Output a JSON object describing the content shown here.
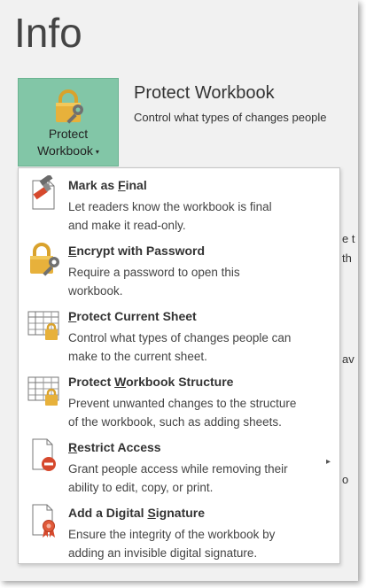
{
  "page": {
    "title": "Info"
  },
  "protect_button": {
    "line1": "Protect",
    "line2": "Workbook",
    "caret": "▾",
    "icon": "lock-key-icon"
  },
  "section": {
    "title": "Protect Workbook",
    "desc": "Control what types of changes people"
  },
  "background_fragments": [
    "e t",
    "th",
    "av",
    "o"
  ],
  "menu": {
    "items": [
      {
        "pre": "Mark as ",
        "key": "F",
        "post": "inal",
        "desc1": "Let readers know the workbook is final",
        "desc2": "and make it read-only.",
        "icon": "mark-as-final-icon"
      },
      {
        "pre": "",
        "key": "E",
        "post": "ncrypt with Password",
        "desc1": "Require a password to open this",
        "desc2": "workbook.",
        "icon": "encrypt-lock-icon"
      },
      {
        "pre": "",
        "key": "P",
        "post": "rotect Current Sheet",
        "desc1": "Control what types of changes people can",
        "desc2": "make to the current sheet.",
        "icon": "protect-sheet-icon"
      },
      {
        "pre": "Protect ",
        "key": "W",
        "post": "orkbook Structure",
        "desc1": "Prevent unwanted changes to the structure",
        "desc2": "of the workbook, such as adding sheets.",
        "icon": "protect-structure-icon"
      },
      {
        "pre": "",
        "key": "R",
        "post": "estrict Access",
        "desc1": "Grant people access while removing their",
        "desc2": "ability to edit, copy, or print.",
        "icon": "restrict-access-icon",
        "arrow": "▸"
      },
      {
        "pre": "Add a Digital ",
        "key": "S",
        "post": "ignature",
        "desc1": "Ensure the integrity of the workbook by",
        "desc2": "adding an invisible digital signature.",
        "icon": "digital-signature-icon"
      }
    ]
  },
  "colors": {
    "accent": "#82c6a7",
    "lock_gold": "#e7b13b",
    "stop_red": "#d6492d"
  }
}
